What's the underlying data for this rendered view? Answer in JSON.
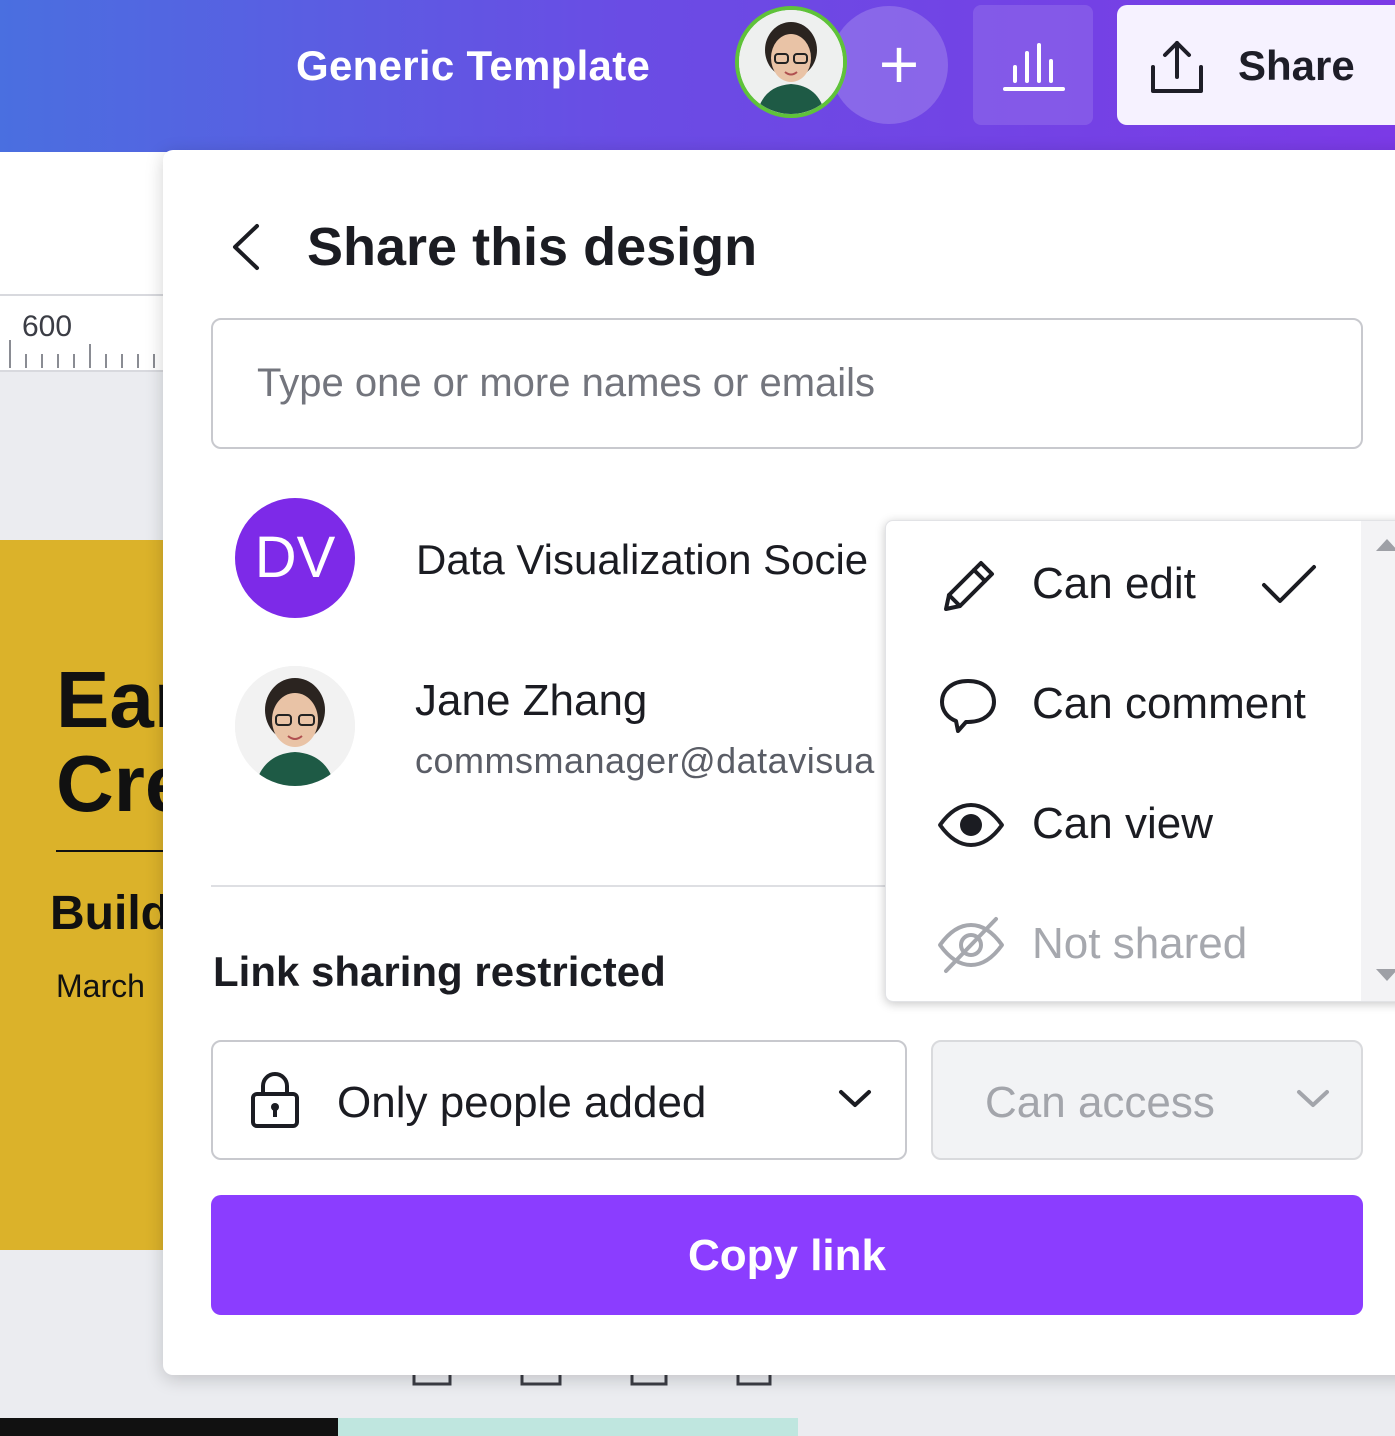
{
  "header": {
    "design_title": "Generic Template",
    "share_label": "Share"
  },
  "canvas": {
    "ruler_value": "600",
    "heading_fragment": "Ear\nCre",
    "subheading_fragment": "Build",
    "date_fragment": "March"
  },
  "share_panel": {
    "title": "Share this design",
    "invite_placeholder": "Type one or more names or emails",
    "people": [
      {
        "initials": "DV",
        "name": "Data Visualization Socie",
        "email": ""
      },
      {
        "initials": "",
        "name": "Jane Zhang",
        "email": "commsmanager@datavisua"
      }
    ],
    "link_heading": "Link sharing restricted",
    "link_access": "Only people added",
    "link_permission": "Can access",
    "copy_link_label": "Copy link"
  },
  "permission_menu": {
    "items": [
      {
        "label": "Can edit",
        "icon": "pencil-icon",
        "selected": true,
        "disabled": false
      },
      {
        "label": "Can comment",
        "icon": "comment-icon",
        "selected": false,
        "disabled": false
      },
      {
        "label": "Can view",
        "icon": "eye-icon",
        "selected": false,
        "disabled": false
      },
      {
        "label": "Not shared",
        "icon": "eye-off-icon",
        "selected": false,
        "disabled": true
      }
    ]
  },
  "colors": {
    "accent": "#8b3dff",
    "avatar_dv": "#7d2ae8",
    "presence_ring": "#5fc23a",
    "header_gradient_start": "#4a6fe0",
    "header_gradient_end": "#7b3ae6"
  }
}
